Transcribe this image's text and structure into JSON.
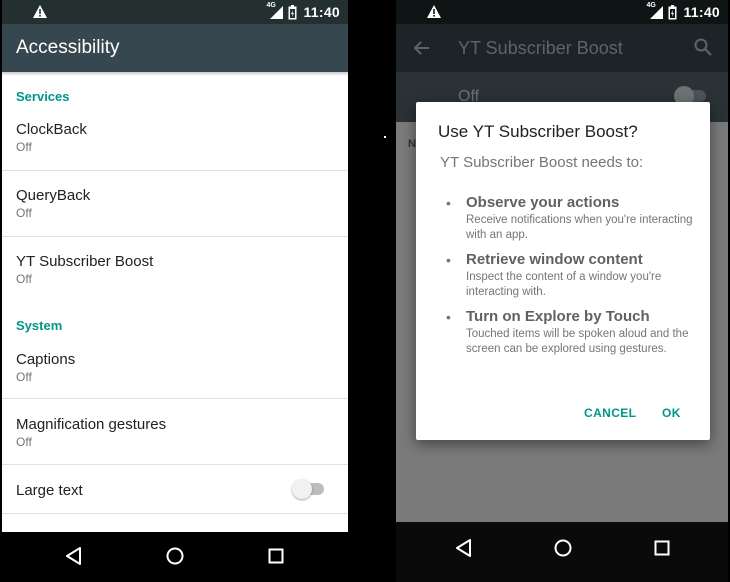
{
  "left_screen": {
    "status_bar": {
      "time": "11:40",
      "network_label": "4G"
    },
    "app_bar": {
      "title": "Accessibility"
    },
    "sections": [
      {
        "header": "Services"
      },
      {
        "header": "System"
      }
    ],
    "items": [
      {
        "title": "ClockBack",
        "status": "Off"
      },
      {
        "title": "QueryBack",
        "status": "Off"
      },
      {
        "title": "YT Subscriber Boost",
        "status": "Off"
      },
      {
        "title": "Captions",
        "status": "Off"
      },
      {
        "title": "Magnification gestures",
        "status": "Off"
      },
      {
        "title": "Large text",
        "toggle": false
      }
    ]
  },
  "right_screen": {
    "status_bar": {
      "time": "11:40",
      "network_label": "4G"
    },
    "app_bar": {
      "title": "YT Subscriber Boost"
    },
    "switch_bar": {
      "label": "Off",
      "toggle": false
    },
    "background_letter": "N",
    "dialog": {
      "title": "Use YT Subscriber Boost?",
      "subtitle": "YT Subscriber Boost needs to:",
      "bullet": "•",
      "permissions": [
        {
          "title": "Observe your actions",
          "description": "Receive notifications when you're interacting with an app."
        },
        {
          "title": "Retrieve window content",
          "description": "Inspect the content of a window you're interacting with."
        },
        {
          "title": "Turn on Explore by Touch",
          "description": "Touched items will be spoken aloud and the screen can be explored using gestures."
        }
      ],
      "cancel_label": "CANCEL",
      "ok_label": "OK"
    }
  },
  "colors": {
    "accent": "#009688",
    "app_bar": "#37474f",
    "status_bar": "#24302f",
    "scrim": "#7a7a7a"
  },
  "icons": [
    "warning-icon",
    "signal-4g-icon",
    "battery-icon",
    "back-arrow-icon",
    "search-icon",
    "nav-back-icon",
    "nav-home-icon",
    "nav-recents-icon"
  ]
}
